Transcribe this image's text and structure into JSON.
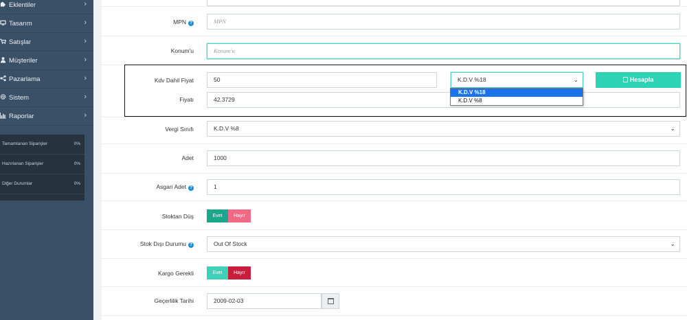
{
  "sidebar": {
    "items": [
      {
        "label": "Eklentiler",
        "icon": "puzzle-icon"
      },
      {
        "label": "Tasarım",
        "icon": "monitor-icon"
      },
      {
        "label": "Satışlar",
        "icon": "cart-icon"
      },
      {
        "label": "Müşteriler",
        "icon": "user-icon"
      },
      {
        "label": "Pazarlama",
        "icon": "share-icon"
      },
      {
        "label": "Sistem",
        "icon": "gear-icon"
      },
      {
        "label": "Raporlar",
        "icon": "bar-chart-icon"
      }
    ],
    "chevron": "›",
    "stats": [
      {
        "label": "Tamamlanan Siparişler",
        "value": "0%"
      },
      {
        "label": "Hazırlanan Siparişler",
        "value": "0%"
      },
      {
        "label": "Diğer Durumlar",
        "value": "0%"
      }
    ]
  },
  "form": {
    "help_icon": "?",
    "mpn": {
      "label": "MPN",
      "placeholder": "MPN"
    },
    "location": {
      "label": "Konum'u",
      "placeholder": "Konum'u"
    },
    "price_incl_tax": {
      "label": "Kdv Dahil Fiyat",
      "value": "50"
    },
    "tax_select": {
      "selected": "K.D.V %18",
      "options": [
        "K.D.V %18",
        "K.D.V %8"
      ]
    },
    "calculate_button": "Hesapla",
    "price": {
      "label": "Fiyatı",
      "value": "42.3729"
    },
    "tax_class": {
      "label": "Vergi Sınıfı",
      "value": "K.D.V %8"
    },
    "quantity": {
      "label": "Adet",
      "value": "1000"
    },
    "min_quantity": {
      "label": "Asgari Adet",
      "value": "1"
    },
    "subtract_stock": {
      "label": "Stoktan Düş",
      "yes": "Evet",
      "no": "Hayır",
      "active": "yes"
    },
    "out_of_stock_status": {
      "label": "Stok Dışı Durumu",
      "value": "Out Of Stock"
    },
    "shipping_required": {
      "label": "Kargo Gerekli",
      "yes": "Evet",
      "no": "Hayır",
      "active": "no"
    },
    "date_available": {
      "label": "Geçerlilik Tarihi",
      "value": "2009-02-03"
    }
  },
  "colors": {
    "sidebar": "#3a5066",
    "accent": "#2ed3b6",
    "danger": "#dc2f4b",
    "focus": "#4fd1c1"
  }
}
